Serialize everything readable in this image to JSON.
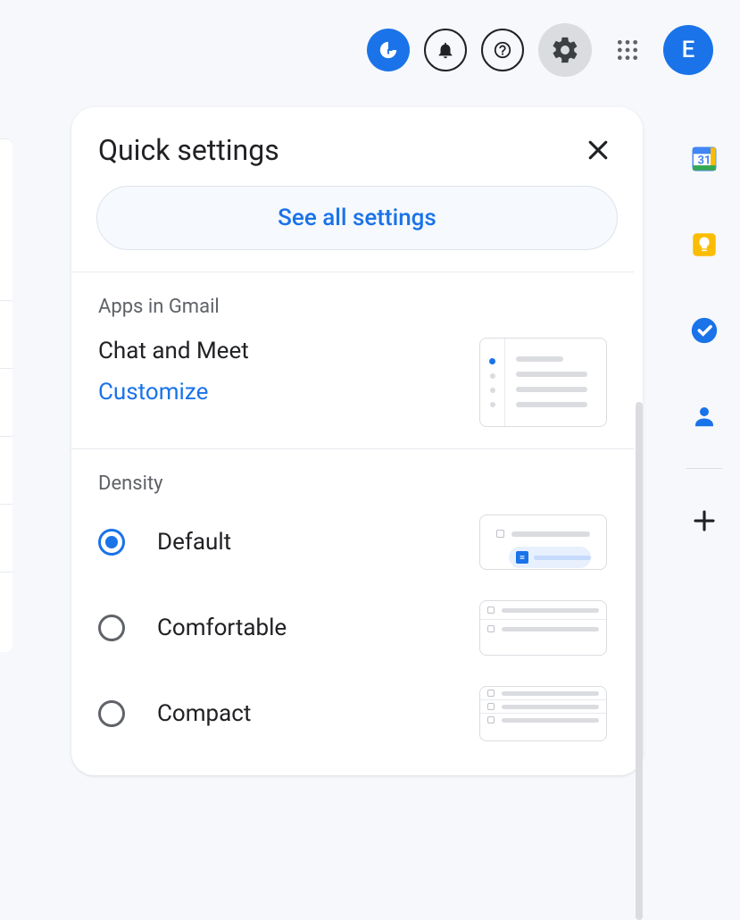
{
  "header": {
    "avatar_letter": "E"
  },
  "panel": {
    "title": "Quick settings",
    "see_all_label": "See all settings",
    "apps_section": {
      "label": "Apps in Gmail",
      "sub_title": "Chat and Meet",
      "customize_label": "Customize"
    },
    "density_section": {
      "label": "Density",
      "options": [
        {
          "label": "Default",
          "selected": true
        },
        {
          "label": "Comfortable",
          "selected": false
        },
        {
          "label": "Compact",
          "selected": false
        }
      ]
    }
  }
}
